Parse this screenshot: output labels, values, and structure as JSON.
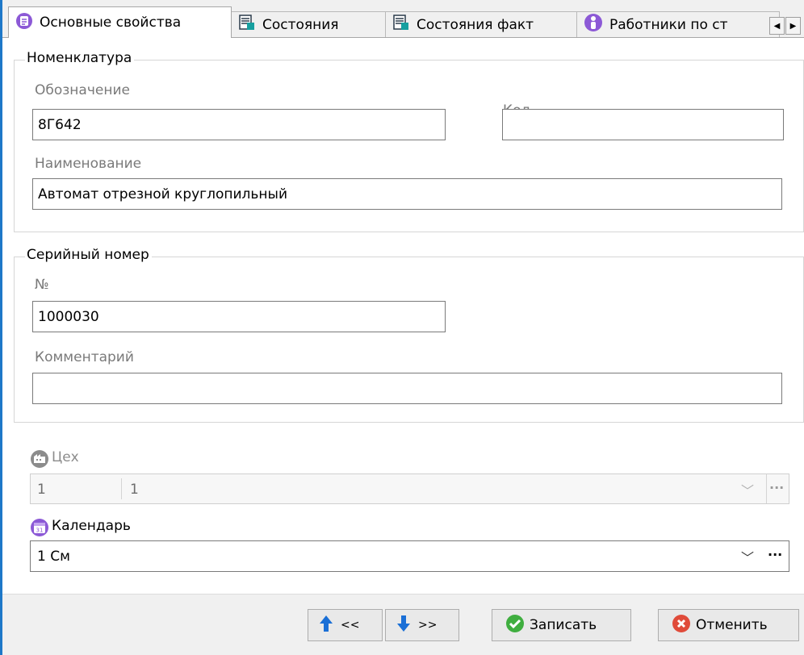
{
  "tabs": [
    {
      "label": "Основные свойства",
      "icon": "list-icon",
      "active": true
    },
    {
      "label": "Состояния",
      "icon": "document-table-icon"
    },
    {
      "label": "Состояния факт",
      "icon": "document-table-icon"
    },
    {
      "label": "Работники по ст",
      "icon": "person-icon"
    }
  ],
  "tab_nav": {
    "left": "◀",
    "right": "▶"
  },
  "nomenclature": {
    "title": "Номенклатура",
    "designation_label": "Обозначение",
    "designation_value": "8Г642",
    "code_label": "Код",
    "code_value": "",
    "name_label": "Наименование",
    "name_value": "Автомат отрезной круглопильный"
  },
  "serial": {
    "title": "Серийный номер",
    "number_label": "№",
    "number_value": "1000030",
    "comment_label": "Комментарий",
    "comment_value": ""
  },
  "workshop": {
    "label": "Цех",
    "code": "1",
    "name": "1",
    "dropdown_glyph": "﹀",
    "more_glyph": "···"
  },
  "calendar": {
    "label": "Календарь",
    "value": "1 См",
    "dropdown_glyph": "﹀",
    "more_glyph": "···"
  },
  "buttons": {
    "prev_label": "<<",
    "next_label": ">>",
    "save_label": "Записать",
    "cancel_label": "Отменить"
  },
  "colors": {
    "accent_purple": "#8c59d6",
    "arrow_blue": "#1a6fd6",
    "save_green": "#3fae3f",
    "cancel_red": "#e04b3a",
    "window_edge": "#1e78c8"
  }
}
